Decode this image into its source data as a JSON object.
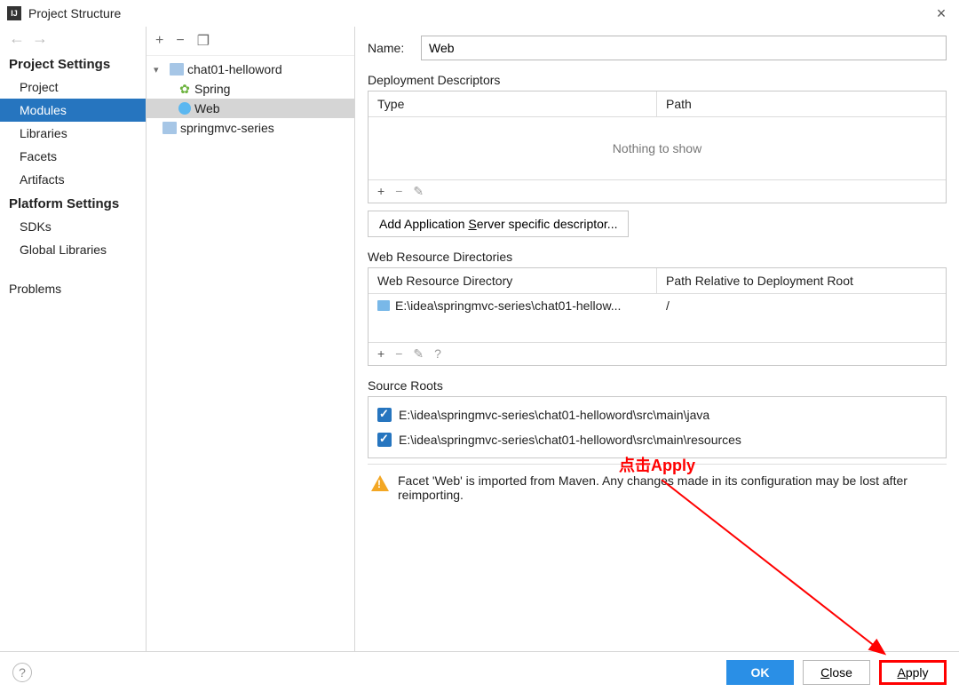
{
  "window": {
    "title": "Project Structure"
  },
  "sidebar": {
    "projectSettingsHeader": "Project Settings",
    "platformSettingsHeader": "Platform Settings",
    "items": {
      "project": "Project",
      "modules": "Modules",
      "libraries": "Libraries",
      "facets": "Facets",
      "artifacts": "Artifacts",
      "sdks": "SDKs",
      "globalLibraries": "Global Libraries",
      "problems": "Problems"
    }
  },
  "tree": {
    "root": "chat01-helloword",
    "children": {
      "spring": "Spring",
      "web": "Web"
    },
    "root2": "springmvc-series"
  },
  "form": {
    "nameLabel": "Name:",
    "nameValue": "Web",
    "deployment": {
      "title": "Deployment Descriptors",
      "colType": "Type",
      "colPath": "Path",
      "empty": "Nothing to show",
      "addBtn": "Add Application Server specific descriptor...",
      "addBtnUnderline": "S"
    },
    "webRes": {
      "title": "Web Resource Directories",
      "col1": "Web Resource Directory",
      "col2": "Path Relative to Deployment Root",
      "rowPath": "E:\\idea\\springmvc-series\\chat01-hellow...",
      "rowRel": "/"
    },
    "sourceRoots": {
      "title": "Source Roots",
      "paths": [
        "E:\\idea\\springmvc-series\\chat01-helloword\\src\\main\\java",
        "E:\\idea\\springmvc-series\\chat01-helloword\\src\\main\\resources"
      ]
    },
    "warning": "Facet 'Web' is imported from Maven. Any changes made in its configuration may be lost after reimporting."
  },
  "annotation": {
    "text": "点击Apply"
  },
  "footer": {
    "ok": "OK",
    "close": "Close",
    "closeUnderline": "C",
    "apply": "Apply",
    "applyUnderline": "A"
  }
}
